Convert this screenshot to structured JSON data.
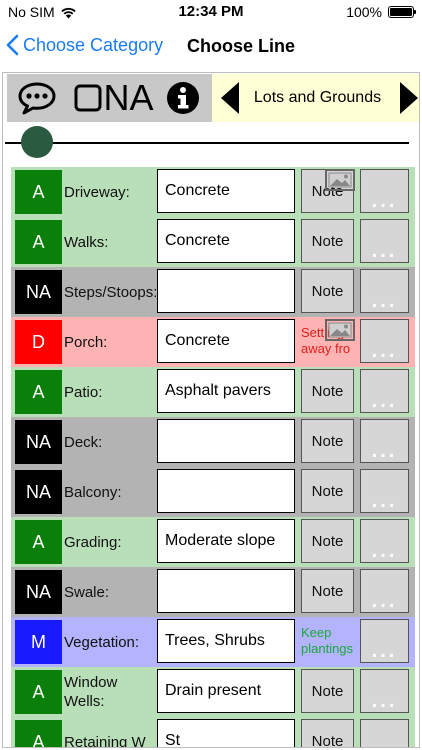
{
  "status": {
    "carrier": "No SIM",
    "time": "12:34 PM",
    "battery": "100%"
  },
  "nav": {
    "back": "Choose Category",
    "title": "Choose Line"
  },
  "toolbar": {
    "na_label": "NA",
    "category": "Lots and Grounds",
    "slider_level": 0.05
  },
  "colors": {
    "A": "#0a7f0a",
    "NA": "#000000",
    "D": "#ff0000",
    "M": "#1a1aff",
    "bgA": "#b9dfb9",
    "bgNA": "#b3b3b3",
    "bgD": "#ffb3b3",
    "bgM": "#b3b3ff"
  },
  "rows": [
    {
      "rating": "A",
      "label": "Driveway:",
      "value": "Concrete",
      "note": "Note",
      "note_style": "button",
      "photo": true
    },
    {
      "rating": "A",
      "label": "Walks:",
      "value": "Concrete",
      "note": "Note",
      "note_style": "button",
      "photo": false
    },
    {
      "rating": "NA",
      "label": "Steps/Stoops:",
      "value": "",
      "note": "Note",
      "note_style": "button",
      "photo": false
    },
    {
      "rating": "D",
      "label": "Porch:",
      "value": "Concrete",
      "note": "Settling away fro",
      "note_style": "red",
      "photo": true
    },
    {
      "rating": "A",
      "label": "Patio:",
      "value": "Asphalt pavers",
      "note": "Note",
      "note_style": "button",
      "photo": false
    },
    {
      "rating": "NA",
      "label": "Deck:",
      "value": "",
      "note": "Note",
      "note_style": "button",
      "photo": false
    },
    {
      "rating": "NA",
      "label": "Balcony:",
      "value": "",
      "note": "Note",
      "note_style": "button",
      "photo": false
    },
    {
      "rating": "A",
      "label": "Grading:",
      "value": "Moderate slope",
      "note": "Note",
      "note_style": "button",
      "photo": false
    },
    {
      "rating": "NA",
      "label": "Swale:",
      "value": "",
      "note": "Note",
      "note_style": "button",
      "photo": false
    },
    {
      "rating": "M",
      "label": "Vegetation:",
      "value": "Trees, Shrubs",
      "note": "Keep plantings",
      "note_style": "green",
      "photo": false
    },
    {
      "rating": "A",
      "label": "Window Wells:",
      "value": "Drain present",
      "note": "Note",
      "note_style": "button",
      "photo": false
    },
    {
      "rating": "A",
      "label": "Retaining W",
      "value": "St",
      "note": "Note",
      "note_style": "button",
      "photo": false
    }
  ]
}
